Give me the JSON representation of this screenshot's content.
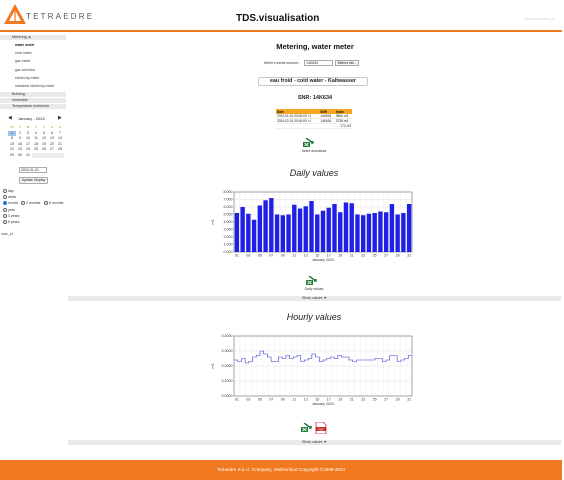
{
  "header": {
    "logo_text": "TETRAEDRE",
    "app_title": "TDS.visualisation",
    "top_link": "disconnect user_pt"
  },
  "sidebar": {
    "metering_label": "Metering ⏶",
    "sub_items": [
      "water meter",
      "heat meter",
      "gaz meter",
      "gaz corrector",
      "electricity meter",
      "industrial electricity meter"
    ],
    "sections": [
      "Building",
      "Immeuble",
      "Temperature extérieure"
    ],
    "calendar": {
      "prev": "◀",
      "next": "▶",
      "title": "January - 2024",
      "weekday_heads": [
        "m",
        "t",
        "w",
        "t",
        "f",
        "s",
        "s"
      ],
      "days": [
        [
          "1",
          "2",
          "3",
          "4",
          "5",
          "6",
          "7"
        ],
        [
          "8",
          "9",
          "10",
          "11",
          "12",
          "13",
          "14"
        ],
        [
          "15",
          "16",
          "17",
          "18",
          "19",
          "20",
          "21"
        ],
        [
          "22",
          "23",
          "24",
          "25",
          "26",
          "27",
          "28"
        ],
        [
          "29",
          "30",
          "31",
          "",
          "",
          "",
          ""
        ]
      ]
    },
    "date_value": "2024-01-01",
    "update_label": "Update Display",
    "radios": {
      "day": "day",
      "week": "week",
      "month": "month",
      "two_months": "2 months",
      "six_months": "6 months",
      "year": "year",
      "three_years": "3 years",
      "six_years": "6 years"
    },
    "user_label": "user_pt"
  },
  "main": {
    "title": "Metering, water meter",
    "serial_label": "Meter's serial number:",
    "serial_value": "14K634",
    "serial_button": "Meters list...",
    "meter_name": "eau froid - cold water - Kaltwasser",
    "snr": "SNR: 14K634",
    "table": {
      "headers": [
        "Date",
        "SNR",
        "Index"
      ],
      "rows": [
        [
          "2024-01-01 00:00:00 +1",
          "14K634",
          "3566 m3"
        ],
        [
          "2024-02-01 00:00:00 +1",
          "14K634",
          "3738 m3"
        ]
      ],
      "total": "172 m3"
    },
    "index_download_label": "Index download",
    "daily_title": "Daily values",
    "daily_download_label": "Daily values",
    "show_values_label": "Show values ▼",
    "hourly_title": "Hourly values",
    "x_axis_label": "January 2024",
    "y_axis_label": "m3",
    "download_icon": "excel-download-icon",
    "pdf_icon": "pdf-icon"
  },
  "colors": {
    "accent": "#f0791f",
    "bar": "#1f1fe6",
    "line": "#3a3ad8",
    "table_head": "#f5a623"
  },
  "chart_data": [
    {
      "type": "bar",
      "title": "Daily values",
      "xlabel": "January 2024",
      "ylabel": "m3",
      "categories": [
        "01",
        "02",
        "03",
        "04",
        "05",
        "06",
        "07",
        "08",
        "09",
        "10",
        "11",
        "12",
        "13",
        "14",
        "15",
        "16",
        "17",
        "18",
        "19",
        "20",
        "21",
        "22",
        "23",
        "24",
        "25",
        "26",
        "27",
        "28",
        "29",
        "30",
        "31"
      ],
      "values": [
        5.2,
        6.0,
        5.1,
        4.3,
        6.2,
        6.9,
        7.2,
        5.0,
        4.9,
        5.0,
        6.3,
        5.8,
        6.1,
        6.8,
        5.0,
        5.5,
        5.9,
        6.4,
        5.3,
        6.6,
        6.5,
        5.0,
        4.9,
        5.1,
        5.2,
        5.4,
        5.3,
        6.4,
        5.0,
        5.2,
        6.4
      ],
      "ylim": [
        0,
        8
      ],
      "yticks": [
        "0.000",
        "1.000",
        "2.000",
        "3.000",
        "4.000",
        "5.000",
        "6.000",
        "7.000",
        "8.000"
      ],
      "xticks": [
        "01",
        "03",
        "05",
        "07",
        "09",
        "11",
        "13",
        "15",
        "17",
        "19",
        "21",
        "23",
        "25",
        "27",
        "29",
        "31"
      ],
      "grid": true
    },
    {
      "type": "line",
      "title": "Hourly values",
      "xlabel": "January 2024",
      "ylabel": "m3",
      "x_day_start": 1,
      "x_day_end": 31,
      "values": [
        0.24,
        0.23,
        0.25,
        0.22,
        0.23,
        0.26,
        0.27,
        0.3,
        0.28,
        0.26,
        0.23,
        0.23,
        0.26,
        0.25,
        0.27,
        0.25,
        0.26,
        0.27,
        0.23,
        0.24,
        0.25,
        0.28,
        0.26,
        0.23,
        0.24,
        0.25,
        0.26,
        0.25,
        0.27,
        0.26,
        0.26,
        0.24,
        0.23,
        0.24,
        0.24,
        0.24,
        0.24,
        0.24,
        0.25,
        0.25,
        0.23,
        0.24,
        0.27,
        0.27,
        0.23,
        0.24,
        0.25,
        0.27
      ],
      "ylim": [
        0,
        0.4
      ],
      "yticks": [
        "0.0000",
        "0.1000",
        "0.2000",
        "0.3000",
        "0.4000"
      ],
      "xticks": [
        "01",
        "03",
        "05",
        "07",
        "09",
        "11",
        "13",
        "15",
        "17",
        "19",
        "21",
        "23",
        "25",
        "27",
        "29",
        "31"
      ],
      "grid": true
    }
  ]
}
